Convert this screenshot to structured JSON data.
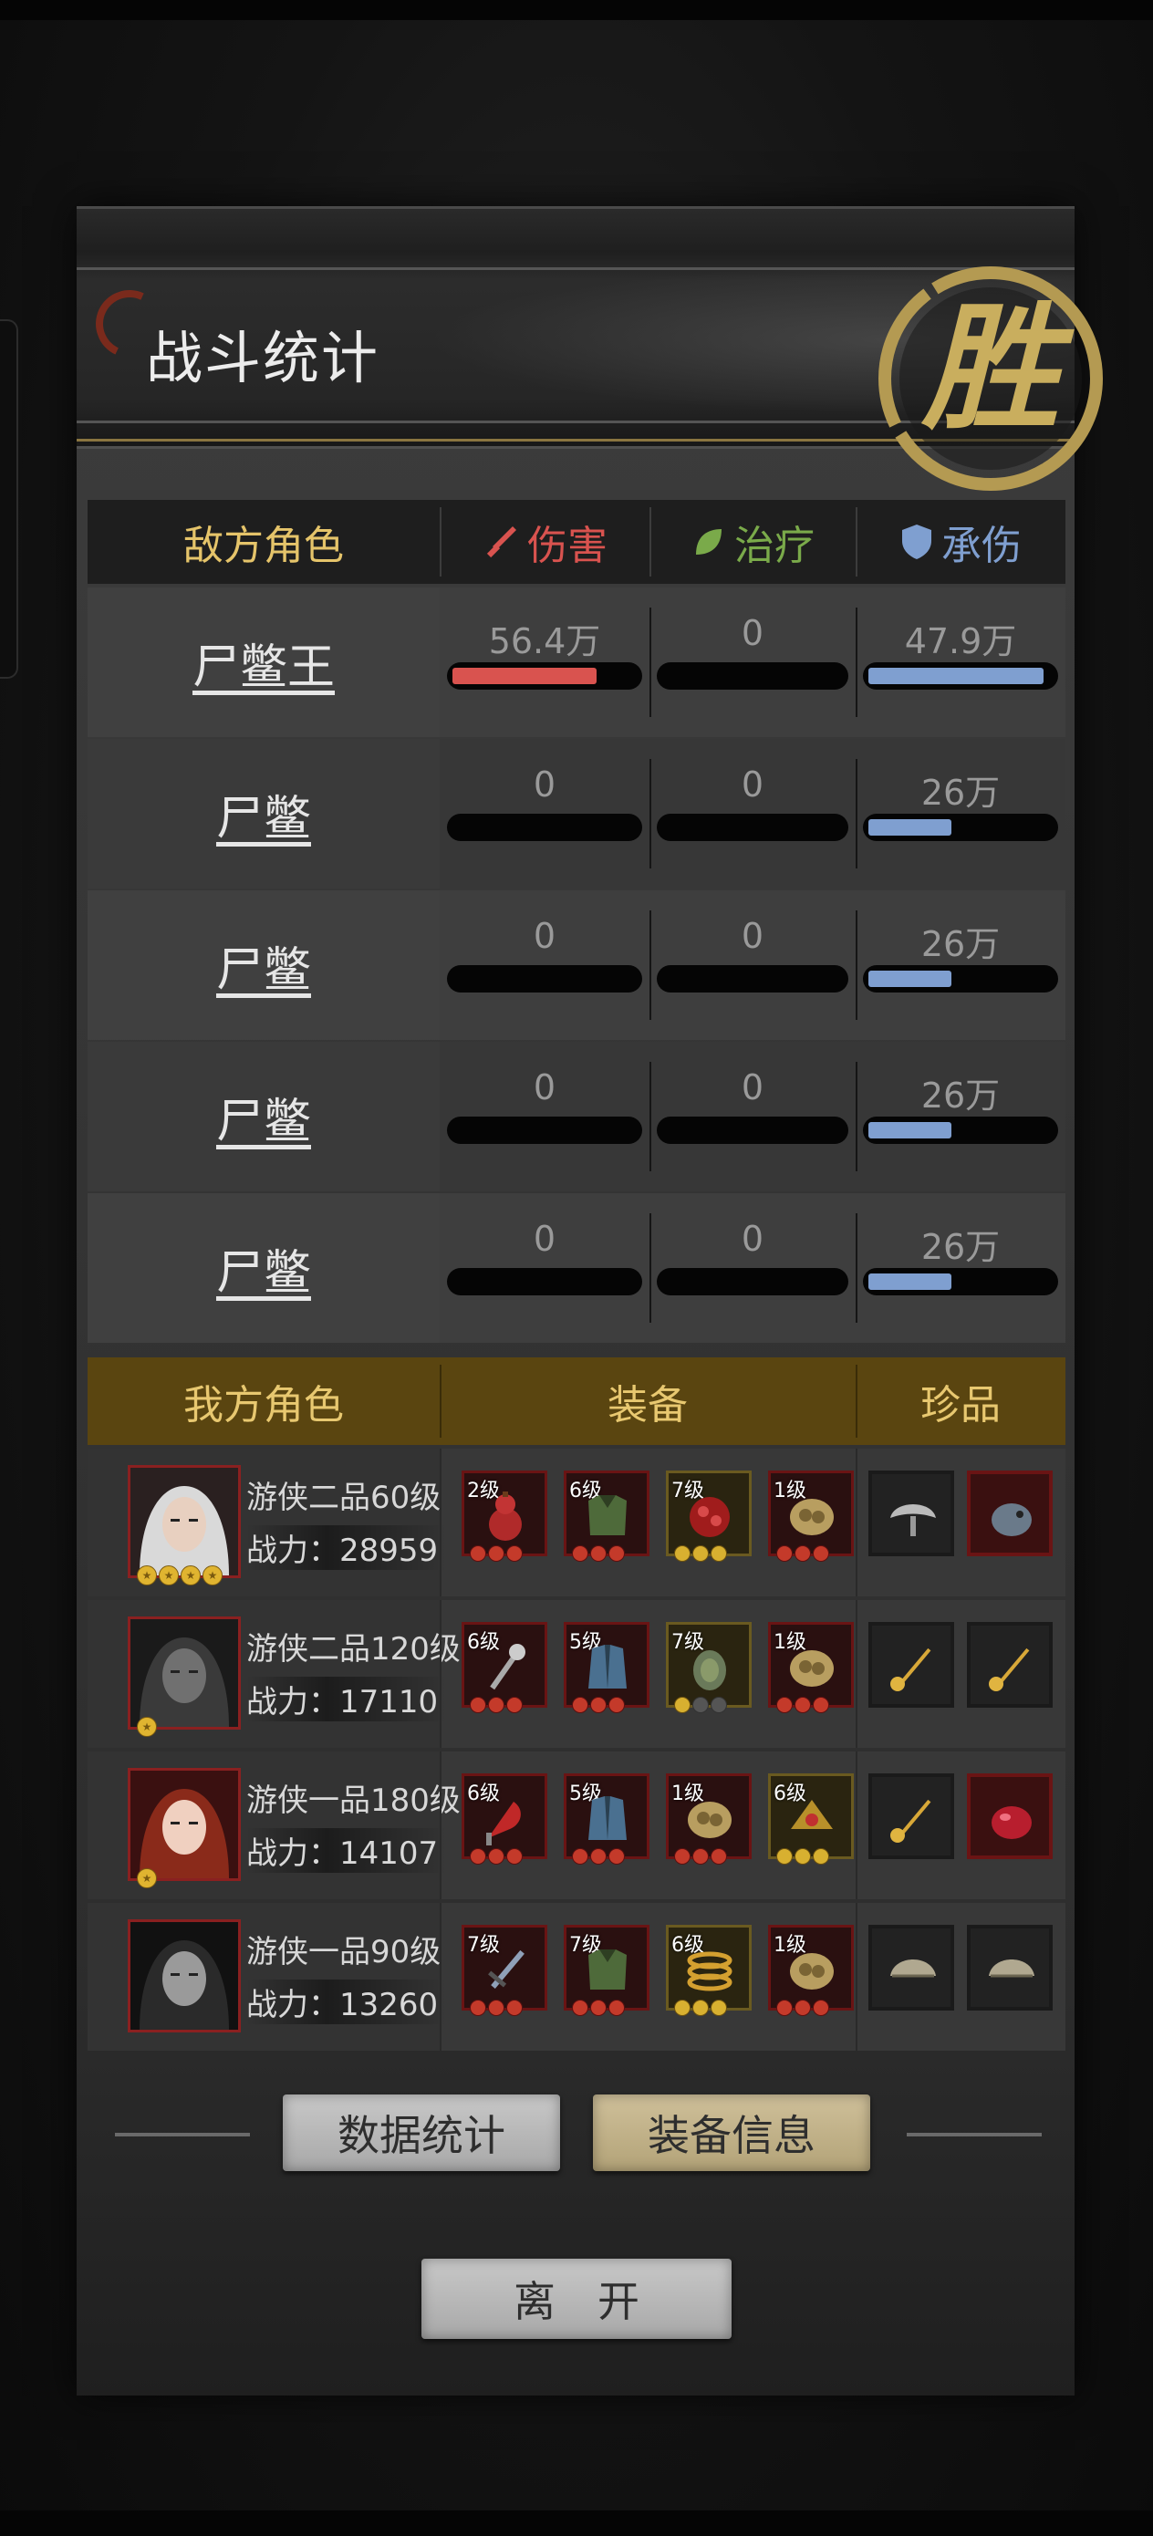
{
  "title": "战斗统计",
  "victory_badge": "胜",
  "enemy_table": {
    "headers": {
      "role": "敌方角色",
      "damage": "伤害",
      "heal": "治疗",
      "taken": "承伤"
    },
    "colors": {
      "damage": "#d9534f",
      "heal": "#7aaa4a",
      "taken": "#7f9fd0",
      "header_role": "#e5c46a"
    },
    "rows": [
      {
        "name": "尸鳖王",
        "damage": "56.4万",
        "damage_fill": 0.78,
        "heal": "0",
        "heal_fill": 0,
        "taken": "47.9万",
        "taken_fill": 0.95
      },
      {
        "name": "尸鳖",
        "damage": "0",
        "damage_fill": 0,
        "heal": "0",
        "heal_fill": 0,
        "taken": "26万",
        "taken_fill": 0.45
      },
      {
        "name": "尸鳖",
        "damage": "0",
        "damage_fill": 0,
        "heal": "0",
        "heal_fill": 0,
        "taken": "26万",
        "taken_fill": 0.45
      },
      {
        "name": "尸鳖",
        "damage": "0",
        "damage_fill": 0,
        "heal": "0",
        "heal_fill": 0,
        "taken": "26万",
        "taken_fill": 0.45
      },
      {
        "name": "尸鳖",
        "damage": "0",
        "damage_fill": 0,
        "heal": "0",
        "heal_fill": 0,
        "taken": "26万",
        "taken_fill": 0.45
      }
    ]
  },
  "my_table": {
    "headers": {
      "role": "我方角色",
      "equipment": "装备",
      "treasure": "珍品"
    },
    "rows": [
      {
        "title": "游侠二品60级",
        "power": "战力：28959",
        "stars": 4,
        "equipment": [
          {
            "level": "2级",
            "icon": "gourd-icon",
            "pips": "rrr"
          },
          {
            "level": "6级",
            "icon": "armor-icon",
            "pips": "rrr"
          },
          {
            "level": "7级",
            "icon": "bead-necklace-icon",
            "pips": "yyy"
          },
          {
            "level": "1级",
            "icon": "jade-pendant-icon",
            "pips": "rrr"
          }
        ],
        "treasures": [
          {
            "icon": "lingzhi-icon",
            "style": "dark"
          },
          {
            "icon": "gem-beast-icon",
            "style": "red"
          }
        ]
      },
      {
        "title": "游侠二品120级",
        "power": "战力：17110",
        "stars": 1,
        "equipment": [
          {
            "level": "6级",
            "icon": "mace-icon",
            "pips": "rrr"
          },
          {
            "level": "5级",
            "icon": "robe-icon",
            "pips": "rrr"
          },
          {
            "level": "7级",
            "icon": "amulet-icon",
            "pips": "ygg"
          },
          {
            "level": "1级",
            "icon": "jade-pendant-icon",
            "pips": "rrr"
          }
        ],
        "treasures": [
          {
            "icon": "hairpin-icon",
            "style": "dark"
          },
          {
            "icon": "hairpin-icon",
            "style": "dark"
          }
        ]
      },
      {
        "title": "游侠一品180级",
        "power": "战力：14107",
        "stars": 1,
        "equipment": [
          {
            "level": "6级",
            "icon": "crescent-blade-icon",
            "pips": "rrr"
          },
          {
            "level": "5级",
            "icon": "robe-icon",
            "pips": "rrr"
          },
          {
            "level": "1级",
            "icon": "jade-pendant-icon",
            "pips": "rrr"
          },
          {
            "level": "6级",
            "icon": "headdress-icon",
            "pips": "yyy"
          }
        ],
        "treasures": [
          {
            "icon": "hairpin-icon",
            "style": "dark"
          },
          {
            "icon": "red-gem-icon",
            "style": "red"
          }
        ]
      },
      {
        "title": "游侠一品90级",
        "power": "战力：13260",
        "stars": 0,
        "equipment": [
          {
            "level": "7级",
            "icon": "sword-icon",
            "pips": "rrr"
          },
          {
            "level": "7级",
            "icon": "armor-icon",
            "pips": "rrr"
          },
          {
            "level": "6级",
            "icon": "bracelet-icon",
            "pips": "yyy"
          },
          {
            "level": "1级",
            "icon": "jade-pendant-icon",
            "pips": "rrr"
          }
        ],
        "treasures": [
          {
            "icon": "comb-icon",
            "style": "dark"
          },
          {
            "icon": "comb-icon",
            "style": "dark"
          }
        ]
      }
    ]
  },
  "buttons": {
    "stats": "数据统计",
    "equipment_info": "装备信息",
    "leave": "离　开"
  }
}
